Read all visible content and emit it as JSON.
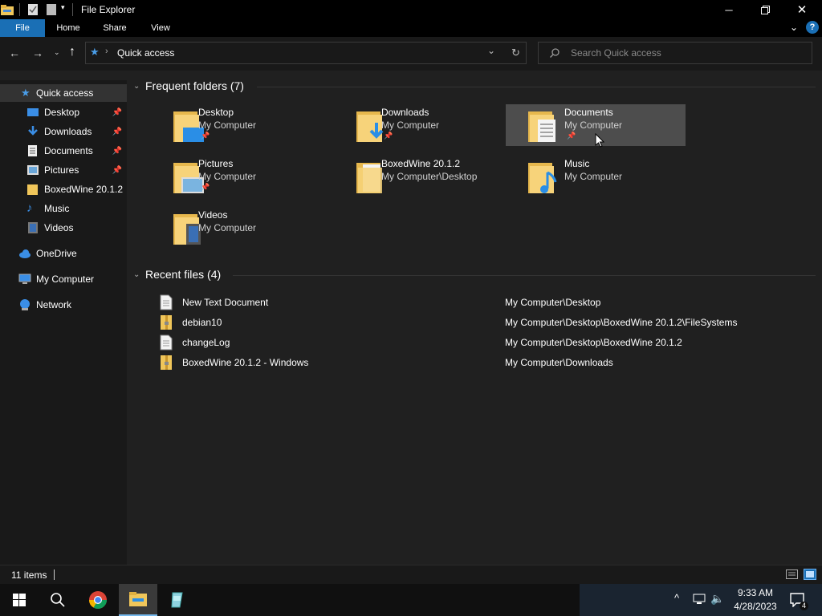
{
  "window": {
    "title": "File Explorer"
  },
  "ribbon": {
    "tabs": [
      "File",
      "Home",
      "Share",
      "View"
    ]
  },
  "address": {
    "path": "Quick access",
    "search_placeholder": "Search Quick access"
  },
  "nav": {
    "items": [
      {
        "label": "Quick access",
        "icon": "star-icon",
        "pinned": false
      },
      {
        "label": "Desktop",
        "icon": "desktop-icon",
        "pinned": true
      },
      {
        "label": "Downloads",
        "icon": "download-icon",
        "pinned": true
      },
      {
        "label": "Documents",
        "icon": "document-icon",
        "pinned": true
      },
      {
        "label": "Pictures",
        "icon": "picture-icon",
        "pinned": true
      },
      {
        "label": "BoxedWine 20.1.2",
        "icon": "folder-icon",
        "pinned": false
      },
      {
        "label": "Music",
        "icon": "music-icon",
        "pinned": false
      },
      {
        "label": "Videos",
        "icon": "video-icon",
        "pinned": false
      },
      {
        "label": "OneDrive",
        "icon": "cloud-icon",
        "pinned": false
      },
      {
        "label": "My Computer",
        "icon": "computer-icon",
        "pinned": false
      },
      {
        "label": "Network",
        "icon": "network-icon",
        "pinned": false
      }
    ]
  },
  "frequent": {
    "title": "Frequent folders (7)",
    "folders": [
      {
        "name": "Desktop",
        "location": "My Computer",
        "pinned": true,
        "selected": false,
        "overlay": "desktop"
      },
      {
        "name": "Downloads",
        "location": "My Computer",
        "pinned": true,
        "selected": false,
        "overlay": "download"
      },
      {
        "name": "Documents",
        "location": "My Computer",
        "pinned": true,
        "selected": true,
        "overlay": "document"
      },
      {
        "name": "Pictures",
        "location": "My Computer",
        "pinned": true,
        "selected": false,
        "overlay": "picture"
      },
      {
        "name": "BoxedWine 20.1.2",
        "location": "My Computer\\Desktop",
        "pinned": false,
        "selected": false,
        "overlay": "paper"
      },
      {
        "name": "Music",
        "location": "My Computer",
        "pinned": false,
        "selected": false,
        "overlay": "music"
      },
      {
        "name": "Videos",
        "location": "My Computer",
        "pinned": false,
        "selected": false,
        "overlay": "video"
      }
    ]
  },
  "recent": {
    "title": "Recent files (4)",
    "files": [
      {
        "name": "New Text Document",
        "path": "My Computer\\Desktop",
        "icon": "text-file-icon"
      },
      {
        "name": "debian10",
        "path": "My Computer\\Desktop\\BoxedWine 20.1.2\\FileSystems",
        "icon": "zip-file-icon"
      },
      {
        "name": "changeLog",
        "path": "My Computer\\Desktop\\BoxedWine 20.1.2",
        "icon": "text-file-icon"
      },
      {
        "name": "BoxedWine 20.1.2 - Windows",
        "path": "My Computer\\Downloads",
        "icon": "zip-file-icon"
      }
    ]
  },
  "status": {
    "items_count": "11 items"
  },
  "taskbar": {
    "time": "9:33 AM",
    "date": "4/28/2023",
    "notification_count": "4"
  },
  "colors": {
    "accent": "#1a6fb5",
    "selected": "#4d4d4d",
    "folder": "#f0c65a"
  }
}
